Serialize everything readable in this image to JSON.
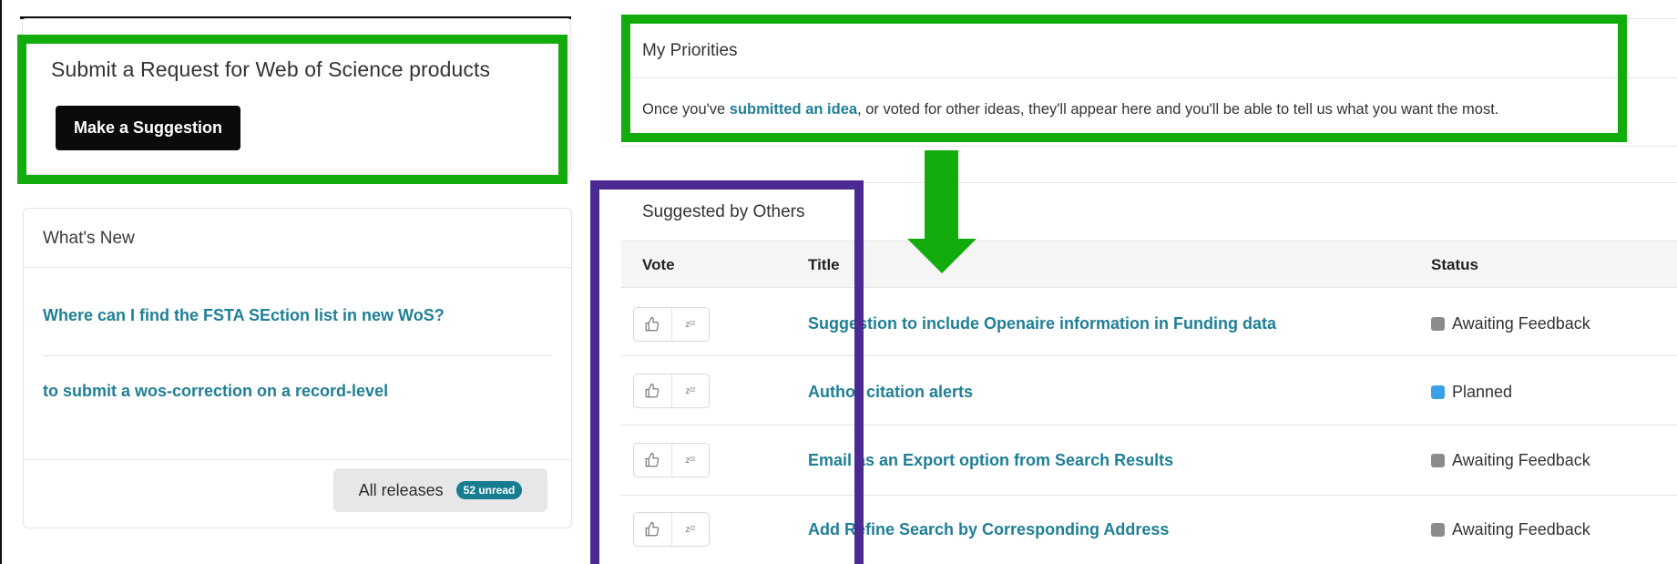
{
  "request": {
    "title": "Submit a Request for Web of Science products",
    "button_label": "Make a Suggestion"
  },
  "whats_new": {
    "title": "What's New",
    "items": [
      {
        "label": "Where can I find the FSTA SEction list in new WoS?"
      },
      {
        "label": "to submit a wos-correction on a record-level"
      }
    ],
    "all_releases_label": "All releases",
    "unread_badge": "52 unread"
  },
  "priorities": {
    "title": "My Priorities",
    "text_before": "Once you've ",
    "link_text": "submitted an idea",
    "text_after": ", or voted for other ideas, they'll appear here and you'll be able to tell us what you want the most."
  },
  "suggested": {
    "title": "Suggested by Others",
    "columns": [
      "Vote",
      "Title",
      "Status"
    ],
    "rows": [
      {
        "title": "Suggestion to include Openaire information in Funding data",
        "status": "Awaiting Feedback",
        "status_color": "#8c8c8c"
      },
      {
        "title": "Author citation alerts",
        "status": "Planned",
        "status_color": "#3aa0e8"
      },
      {
        "title": "Email as an Export option from Search Results",
        "status": "Awaiting Feedback",
        "status_color": "#8c8c8c"
      },
      {
        "title": "Add Refine Search by Corresponding Address",
        "status": "Awaiting Feedback",
        "status_color": "#8c8c8c"
      }
    ],
    "vote_icons": [
      "thumbs-up-icon",
      "snooze-icon"
    ],
    "snooze_glyph": "zᶻᶻ"
  },
  "colors": {
    "annotation_green": "#12ad0c",
    "annotation_purple": "#4b2a92",
    "link_teal": "#1f7f96"
  }
}
